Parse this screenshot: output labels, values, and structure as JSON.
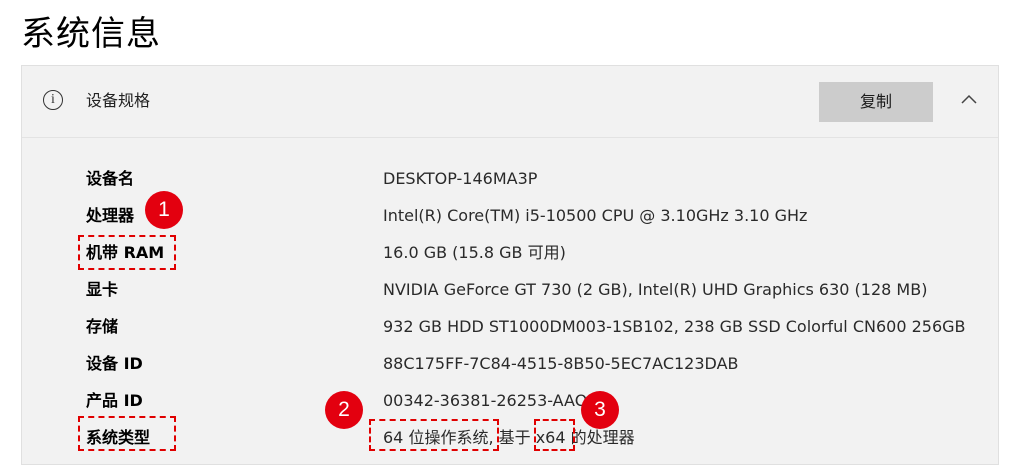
{
  "page": {
    "title": "系统信息"
  },
  "specs": {
    "header_title": "设备规格",
    "copy_label": "复制",
    "icons": {
      "info": "info-icon",
      "collapse": "chevron-up-icon"
    },
    "rows": [
      {
        "label": "设备名",
        "value": "DESKTOP-146MA3P"
      },
      {
        "label": "处理器",
        "value": "Intel(R) Core(TM) i5-10500 CPU @ 3.10GHz   3.10 GHz"
      },
      {
        "label": "机带 RAM",
        "value": "16.0 GB (15.8 GB 可用)"
      },
      {
        "label": "显卡",
        "value": "NVIDIA GeForce GT 730 (2 GB), Intel(R) UHD Graphics 630 (128 MB)"
      },
      {
        "label": "存储",
        "value": "932 GB HDD ST1000DM003-1SB102, 238 GB SSD Colorful CN600 256GB"
      },
      {
        "label": "设备 ID",
        "value": "88C175FF-7C84-4515-8B50-5EC7AC123DAB"
      },
      {
        "label": "产品 ID",
        "value": "00342-36381-26253-AAOEM"
      },
      {
        "label": "系统类型",
        "value": "64 位操作系统, 基于 x64 的处理器"
      }
    ]
  },
  "annotations": {
    "markers": [
      "1",
      "2",
      "3"
    ],
    "color": "#e3000f"
  }
}
